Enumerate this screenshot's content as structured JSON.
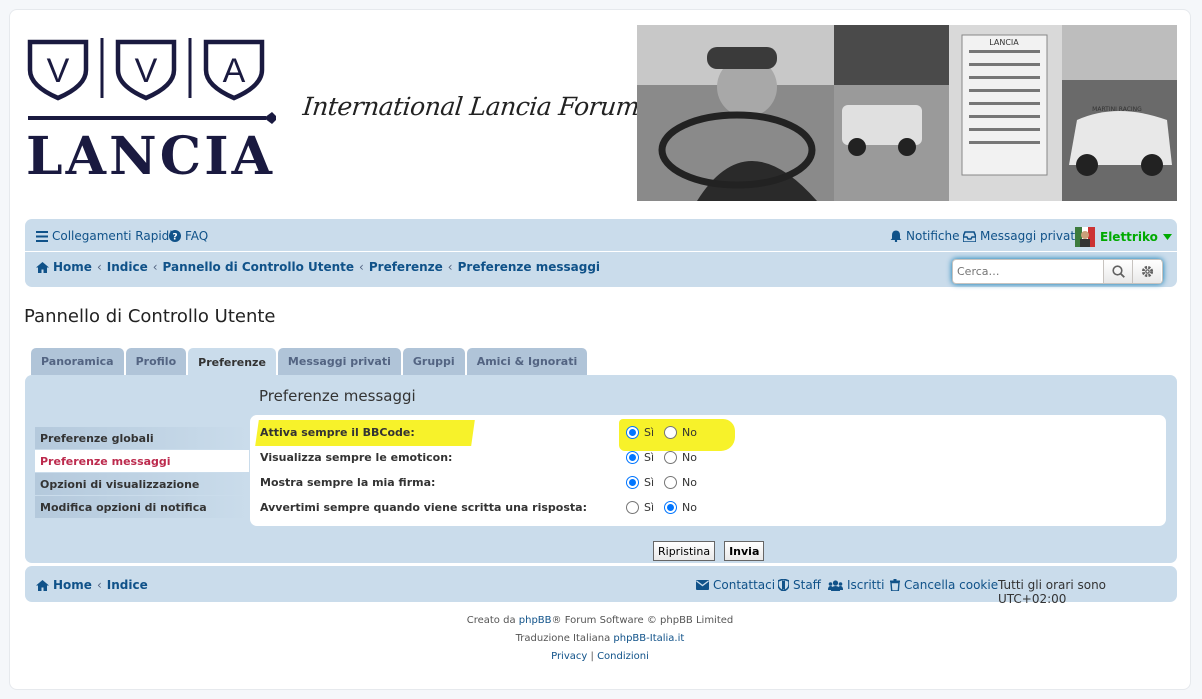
{
  "header": {
    "logo_viva_letters": [
      "V",
      "V",
      "A"
    ],
    "logo_brand": "LANCIA",
    "slogan": "International Lancia Forums",
    "banner_sign": "LANCIA",
    "banner_car_sign": "MARTINI RACING"
  },
  "navbar": {
    "quick_links": "Collegamenti Rapidi",
    "faq": "FAQ",
    "notifications": "Notifiche",
    "private_messages": "Messaggi privati",
    "username": "Elettriko",
    "breadcrumbs": [
      "Home",
      "Indice",
      "Pannello di Controllo Utente",
      "Preferenze",
      "Preferenze messaggi"
    ],
    "search_placeholder": "Cerca…"
  },
  "page_title": "Pannello di Controllo Utente",
  "tabs": [
    "Panoramica",
    "Profilo",
    "Preferenze",
    "Messaggi privati",
    "Gruppi",
    "Amici & Ignorati"
  ],
  "active_tab": "Preferenze",
  "sidebar": [
    "Preferenze globali",
    "Preferenze messaggi",
    "Opzioni di visualizzazione",
    "Modifica opzioni di notifica"
  ],
  "active_sidebar": "Preferenze messaggi",
  "section_title": "Preferenze messaggi",
  "options": [
    {
      "label": "Attiva sempre il BBCode:",
      "yes": "Sì",
      "no": "No",
      "selected": "yes",
      "highlighted": true
    },
    {
      "label": "Visualizza sempre le emoticon:",
      "yes": "Sì",
      "no": "No",
      "selected": "yes",
      "highlighted": false
    },
    {
      "label": "Mostra sempre la mia firma:",
      "yes": "Sì",
      "no": "No",
      "selected": "yes",
      "highlighted": false
    },
    {
      "label": "Avvertimi sempre quando viene scritta una risposta:",
      "yes": "Sì",
      "no": "No",
      "selected": "no",
      "highlighted": false
    }
  ],
  "buttons": {
    "reset": "Ripristina",
    "submit": "Invia"
  },
  "footer": {
    "breadcrumbs": [
      "Home",
      "Indice"
    ],
    "contacts": "Contattaci",
    "staff": "Staff",
    "members": "Iscritti",
    "delete_cookies": "Cancella cookie",
    "timezone": "Tutti gli orari sono UTC+02:00",
    "line1_pre": "Creato da ",
    "line1_link": "phpBB",
    "line1_post": "® Forum Software © phpBB Limited",
    "line2_pre": "Traduzione Italiana ",
    "line2_link": "phpBB-Italia.it",
    "privacy": "Privacy",
    "divider": "|",
    "terms": "Condizioni"
  },
  "colors": {
    "nav_bg": "#cadceb",
    "link": "#105289",
    "highlight": "#f7f22a",
    "active_side": "#bc2a4d",
    "username": "#00aa00"
  }
}
